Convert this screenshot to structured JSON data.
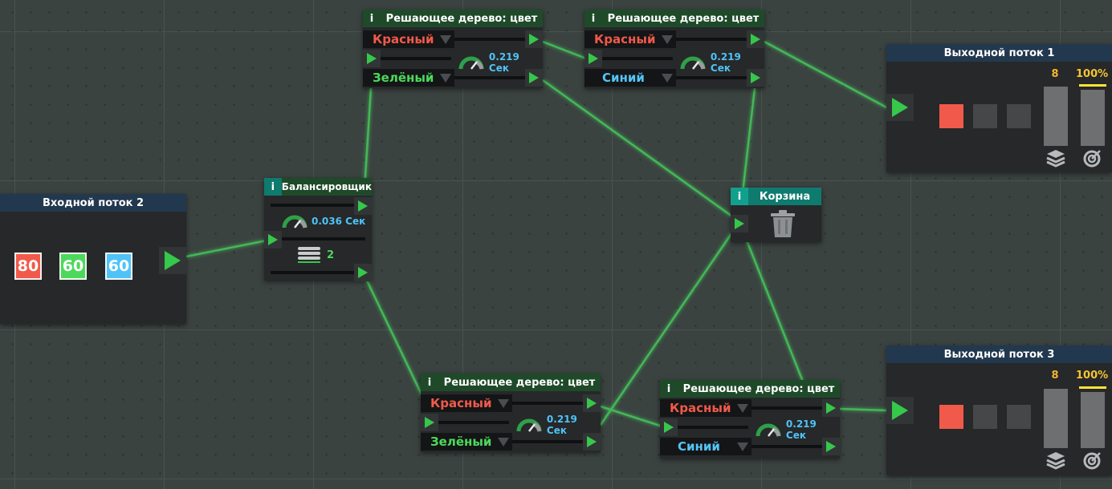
{
  "input_stream": {
    "title": "Входной поток 2",
    "counts": [
      "80",
      "60",
      "60"
    ]
  },
  "balancer": {
    "title": "Балансировщик",
    "info": "i",
    "time": "0.036 Сек",
    "count": "2"
  },
  "tree_top_left": {
    "title": "Решающее дерево: цвет",
    "info": "i",
    "opt1": "Красный",
    "opt2": "Зелёный",
    "time": "0.219 Сек"
  },
  "tree_top_right": {
    "title": "Решающее дерево: цвет",
    "info": "i",
    "opt1": "Красный",
    "opt2": "Синий",
    "time": "0.219 Сек"
  },
  "tree_bottom_left": {
    "title": "Решающее дерево: цвет",
    "info": "i",
    "opt1": "Красный",
    "opt2": "Зелёный",
    "time": "0.219 Сек"
  },
  "tree_bottom_right": {
    "title": "Решающее дерево: цвет",
    "info": "i",
    "opt1": "Красный",
    "opt2": "Синий",
    "time": "0.219 Сек"
  },
  "trash": {
    "title": "Корзина",
    "info": "i"
  },
  "output1": {
    "title": "Выходной поток 1",
    "capacity": "8",
    "percent": "100%",
    "percent_value": 1.0
  },
  "output3": {
    "title": "Выходной поток 3",
    "capacity": "8",
    "percent": "100%",
    "percent_value": 1.0
  },
  "icons": [
    "info-icon",
    "speedometer-icon",
    "trash-icon",
    "layers-icon",
    "target-icon",
    "server-stack-icon"
  ],
  "colors": {
    "wire": "#44c45a",
    "header_green": "#1f4a2a",
    "header_teal": "#0f7a6e",
    "header_blue": "#22384e",
    "red": "#f15a4a",
    "green": "#4cd95b",
    "blue": "#55c5f5",
    "yellow": "#ffe23a"
  }
}
